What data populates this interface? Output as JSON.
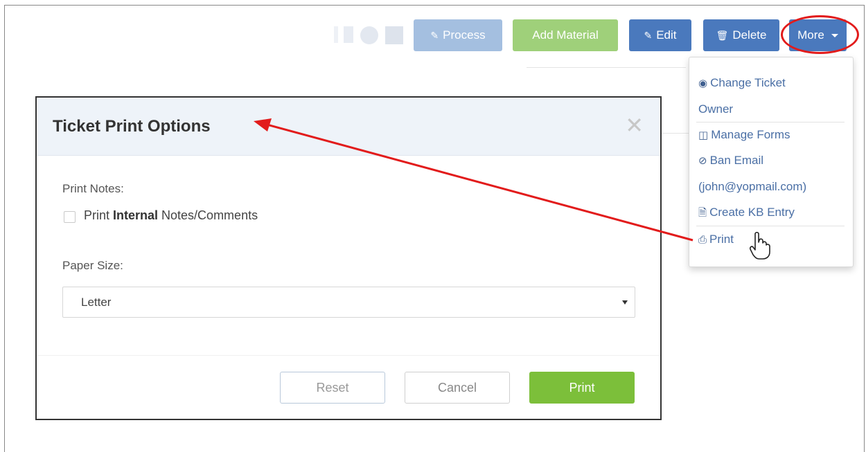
{
  "toolbar": {
    "process_label": "Process",
    "add_material_label": "Add Material",
    "edit_label": "Edit",
    "delete_label": "Delete",
    "more_label": "More"
  },
  "more_menu": {
    "items": [
      {
        "label_line1": "Change Ticket",
        "label_line2": "Owner",
        "icon": "user-circle-icon"
      },
      {
        "label": "Manage Forms",
        "icon": "forms-icon"
      },
      {
        "label_line1": "Ban Email",
        "label_line2": "(john@yopmail.com)",
        "icon": "ban-icon"
      },
      {
        "label": "Create KB Entry",
        "icon": "document-icon"
      },
      {
        "label": "Print",
        "icon": "printer-icon"
      }
    ]
  },
  "modal": {
    "title": "Ticket Print Options",
    "print_notes_label": "Print Notes:",
    "checkbox_prefix": "Print ",
    "checkbox_bold": "Internal",
    "checkbox_suffix": " Notes/Comments",
    "checkbox_checked": false,
    "paper_size_label": "Paper Size:",
    "paper_size_value": "Letter",
    "reset_label": "Reset",
    "cancel_label": "Cancel",
    "print_label": "Print"
  },
  "colors": {
    "primary": "#4a79bd",
    "success": "#7cbf3a",
    "annotation": "#e21b1b"
  }
}
